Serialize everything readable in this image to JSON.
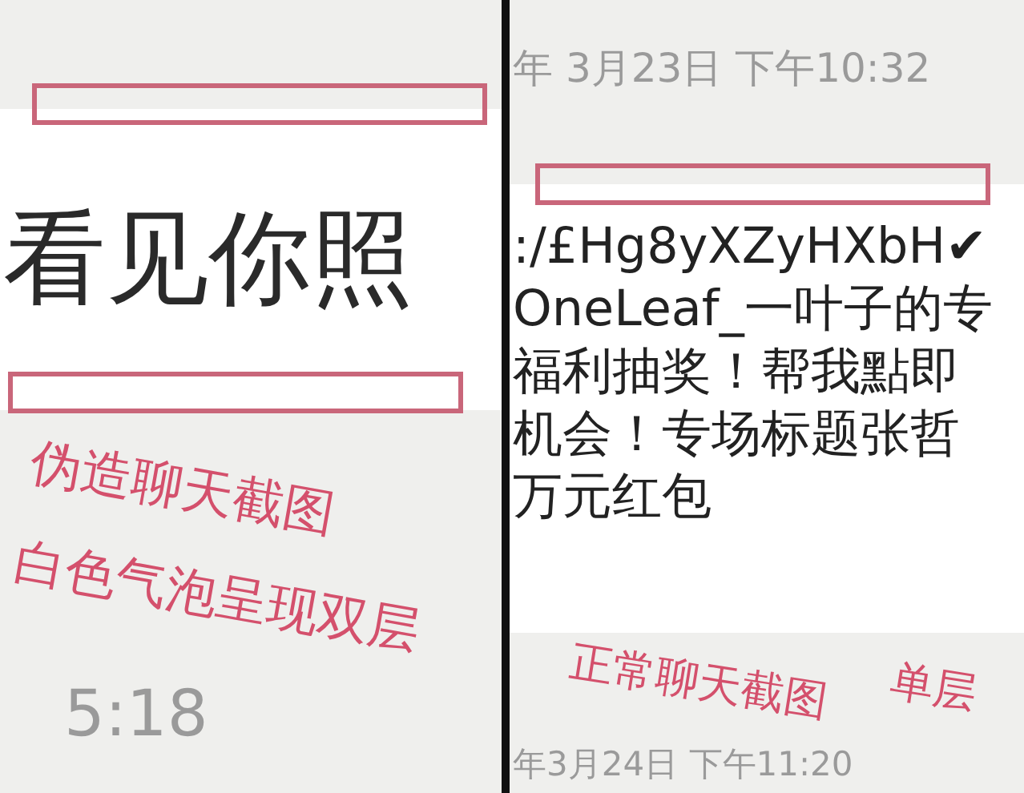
{
  "left_panel": {
    "message": "看见你照",
    "timestamp": "5:18",
    "annotation_lines": [
      "伪造聊天截图",
      "白色气泡呈现双层"
    ]
  },
  "right_panel": {
    "timestamp_top": "年 3月23日 下午10:32",
    "message_lines": [
      ":/£Hg8yXZyHXbH✔",
      "OneLeaf_一叶子的专",
      "福利抽奖！帮我點即",
      "机会！专场标题张哲",
      "万元红包"
    ],
    "timestamp_bottom": "年3月24日 下午11:20",
    "annotation_lines": [
      "正常聊天截图",
      "单层"
    ]
  }
}
